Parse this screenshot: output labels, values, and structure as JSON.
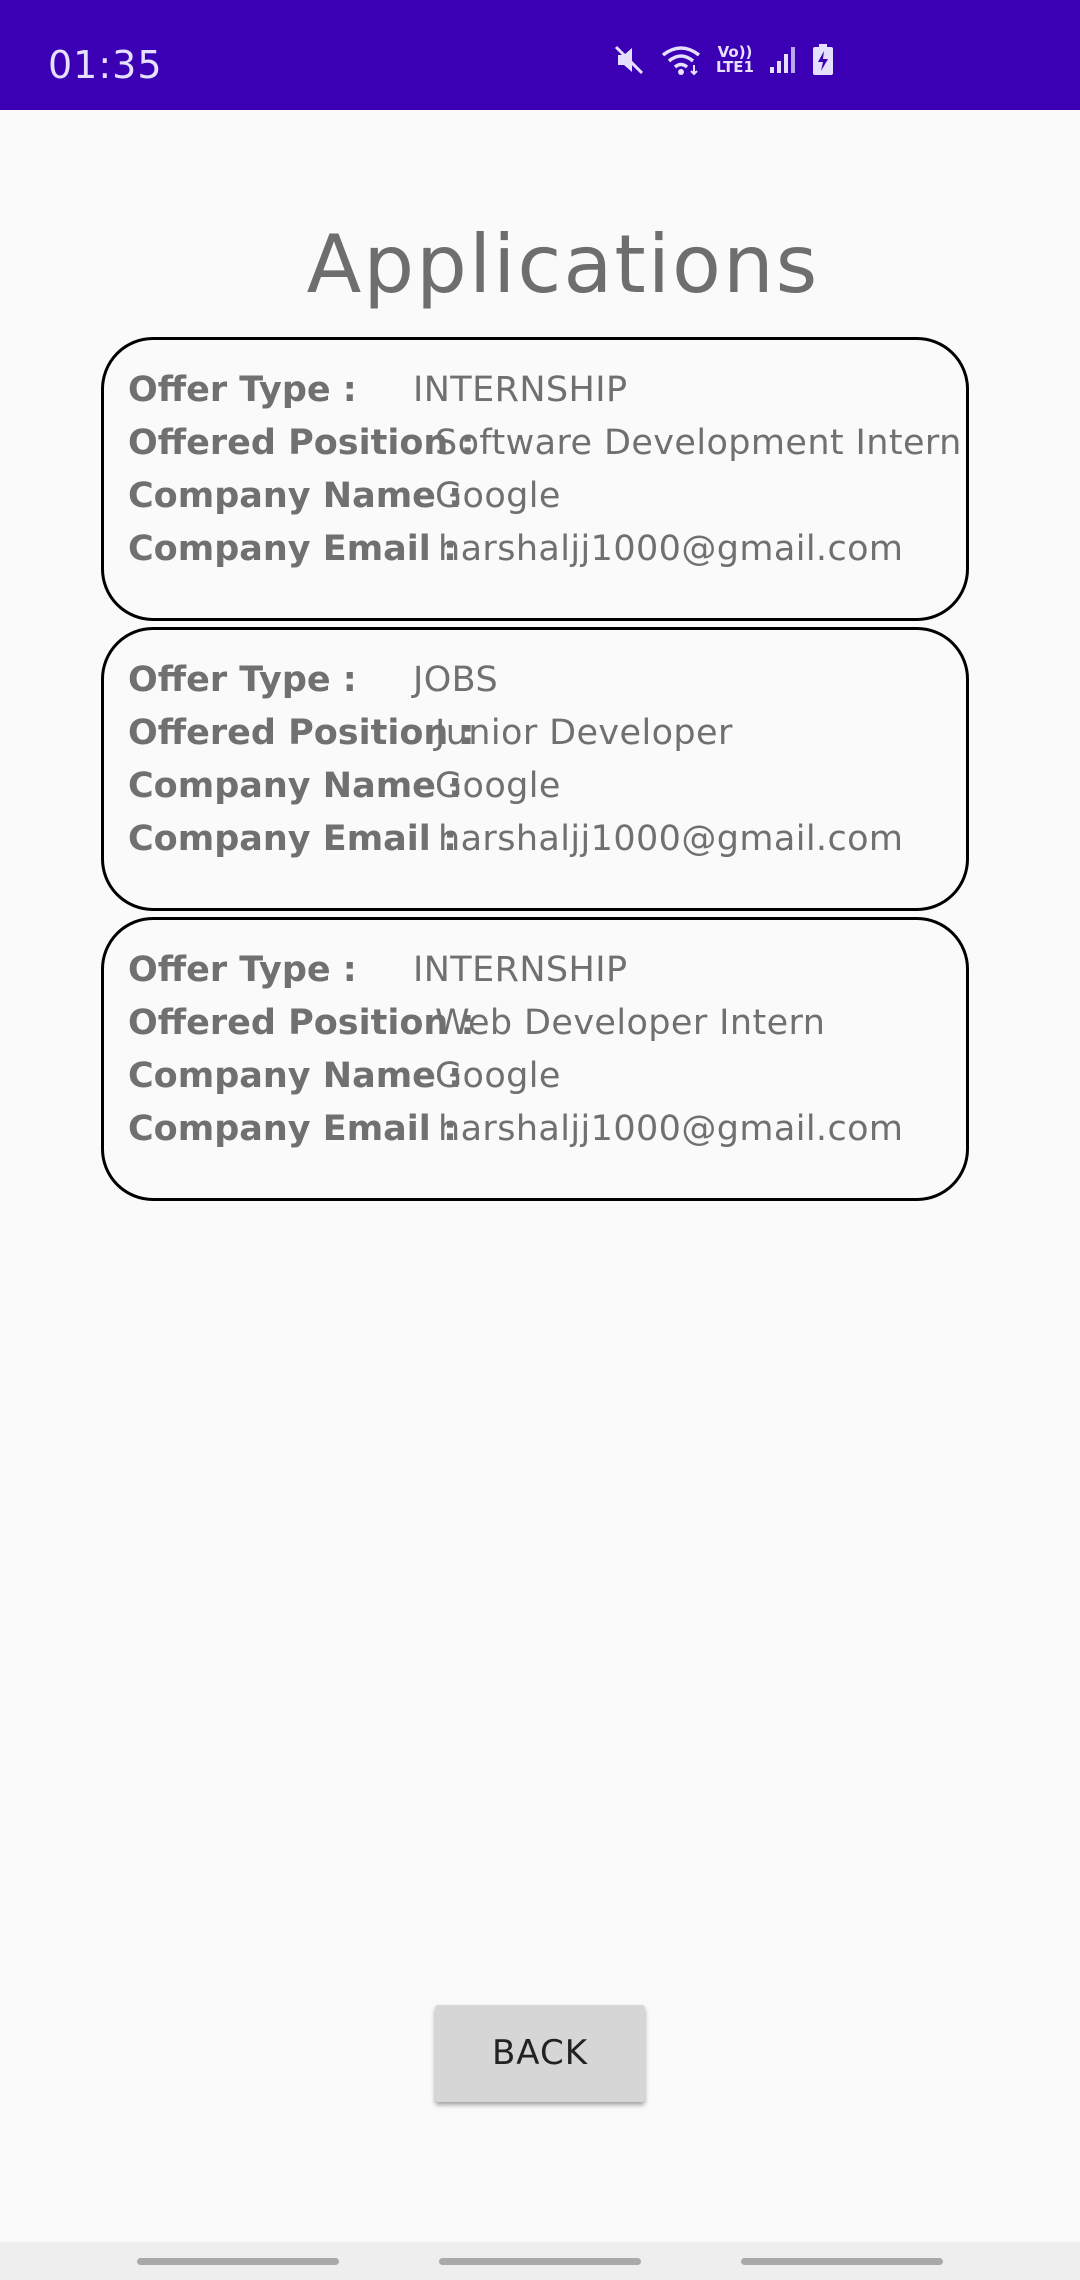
{
  "status_bar": {
    "time": "01:35",
    "icons": [
      "mute-icon",
      "wifi-icon",
      "volte-icon",
      "signal-icon",
      "battery-charging-icon"
    ],
    "volte_label_top": "Vo))",
    "volte_label_bottom": "LTE1"
  },
  "page": {
    "title": "Applications"
  },
  "labels": {
    "offer_type": "Offer Type :",
    "offered_position": "Offered Position :",
    "company_name": "Company Name :",
    "company_email": "Company Email :"
  },
  "applications": [
    {
      "offer_type": "INTERNSHIP",
      "offered_position": "Software Development Intern",
      "company_name": "Google",
      "company_email": "harshaljj1000@gmail.com"
    },
    {
      "offer_type": "JOBS",
      "offered_position": "Junior Developer",
      "company_name": "Google",
      "company_email": "harshaljj1000@gmail.com"
    },
    {
      "offer_type": "INTERNSHIP",
      "offered_position": "Web Developer Intern",
      "company_name": "Google",
      "company_email": "harshaljj1000@gmail.com"
    }
  ],
  "actions": {
    "back_label": "BACK"
  },
  "colors": {
    "status_bar": "#3c00b4",
    "background": "#fafafa",
    "text": "#707070",
    "button": "#d6d6d6"
  }
}
